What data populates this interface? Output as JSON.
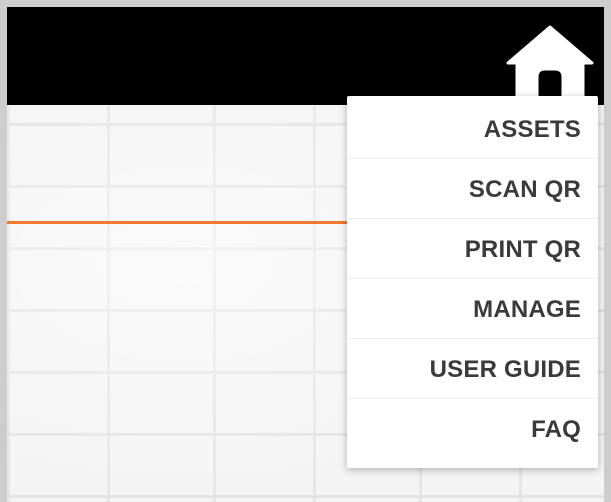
{
  "header": {
    "home_icon": "home-icon",
    "background_color": "#000000",
    "icon_color": "#ffffff"
  },
  "divider": {
    "color": "#f07830"
  },
  "menu": {
    "items": [
      {
        "label": "ASSETS"
      },
      {
        "label": "SCAN QR"
      },
      {
        "label": "PRINT QR"
      },
      {
        "label": "MANAGE"
      },
      {
        "label": "USER GUIDE"
      },
      {
        "label": "FAQ"
      }
    ]
  }
}
